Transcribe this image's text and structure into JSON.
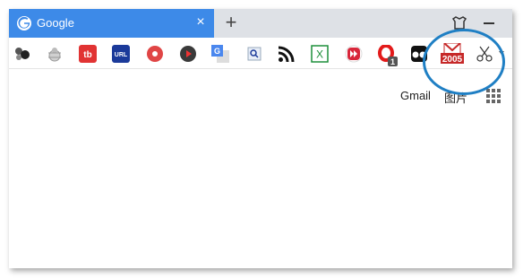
{
  "tab": {
    "title": "Google",
    "close_glyph": "×",
    "favicon": "google-g-icon"
  },
  "tabstrip": {
    "new_tab_glyph": "+"
  },
  "extensions": [
    {
      "name": "spheres-ext-icon"
    },
    {
      "name": "bug-ext-icon"
    },
    {
      "name": "tb-ext-icon",
      "label": "tb"
    },
    {
      "name": "url-ext-icon",
      "label": "URL"
    },
    {
      "name": "record-ext-icon"
    },
    {
      "name": "play-ext-icon"
    },
    {
      "name": "translate-ext-icon",
      "label": "G"
    },
    {
      "name": "magnifier-ext-icon"
    },
    {
      "name": "rss-ext-icon"
    },
    {
      "name": "x-ext-icon",
      "label": "X"
    },
    {
      "name": "fast-forward-ext-icon"
    },
    {
      "name": "opera-badge-ext-icon",
      "badge": "1"
    },
    {
      "name": "tampermonkey-ext-icon"
    },
    {
      "name": "gmail-2005-ext-icon",
      "label": "2005"
    },
    {
      "name": "scissors-ext-icon"
    }
  ],
  "page": {
    "gmail_link": "Gmail",
    "images_link": "图片"
  },
  "colors": {
    "tab_active": "#3d8ae8",
    "highlight_ring": "#1f7fc4",
    "tabstrip_bg": "#dee1e6"
  }
}
